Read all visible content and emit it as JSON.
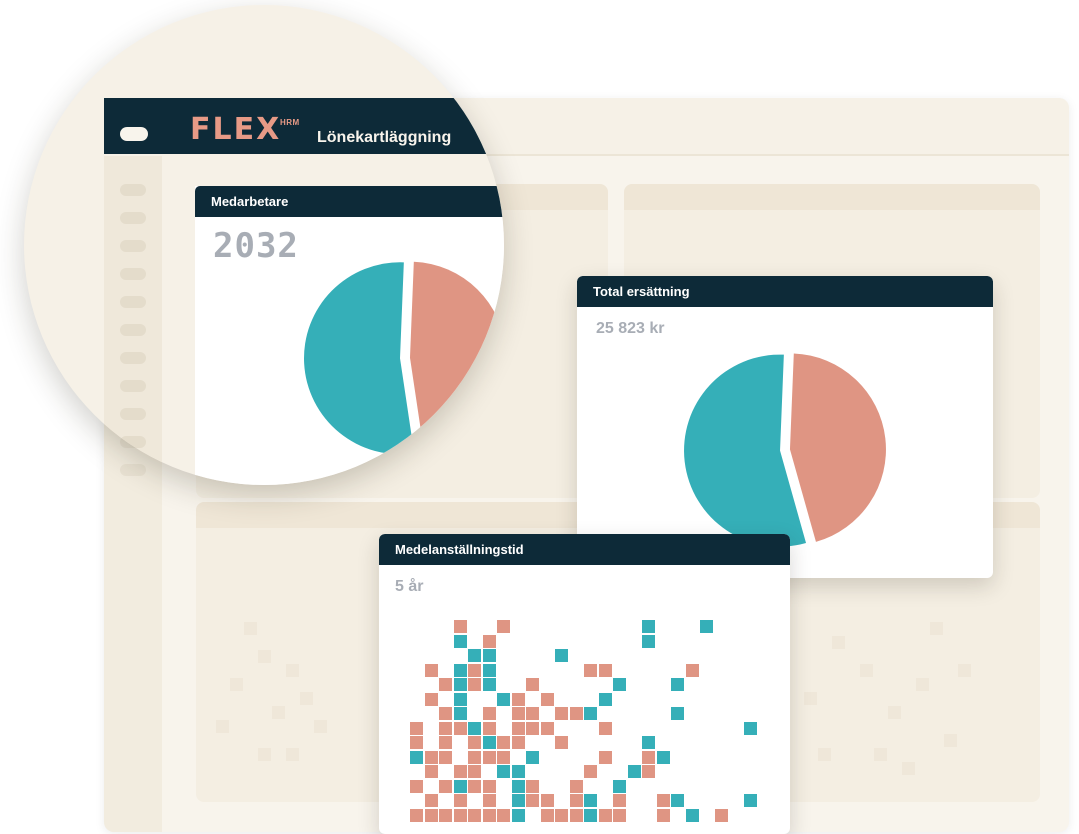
{
  "app": {
    "logo": "FLEX",
    "logo_sup": "HRM",
    "module_title": "Lönekartläggning"
  },
  "icons": {
    "menu": "menu-pill-icon"
  },
  "colors": {
    "navy": "#0d2a38",
    "teal": "#35afb8",
    "salmon": "#df9583",
    "cream": "#f8f4ec"
  },
  "cards": {
    "employees": {
      "title": "Medarbetare",
      "value": "2032"
    },
    "compensation": {
      "title": "Total ersättning",
      "value": "25 823 kr"
    },
    "tenure": {
      "title": "Medelanställningstid",
      "value": "5 år"
    }
  },
  "chart_data": [
    {
      "type": "pie",
      "title": "Medarbetare",
      "slices": [
        {
          "color": "#df9583",
          "value": 47
        },
        {
          "color": "#35afb8",
          "value": 53
        }
      ]
    },
    {
      "type": "pie",
      "title": "Total ersättning",
      "slices": [
        {
          "color": "#df9583",
          "value": 45
        },
        {
          "color": "#35afb8",
          "value": 55
        }
      ]
    },
    {
      "type": "heatmap",
      "title": "Medelanställningstid",
      "series": [
        {
          "color": "#df9583",
          "cells": [
            [
              3,
              0
            ],
            [
              6,
              0
            ],
            [
              5,
              1
            ],
            [
              1,
              3
            ],
            [
              4,
              3
            ],
            [
              12,
              3
            ],
            [
              13,
              3
            ],
            [
              19,
              3
            ],
            [
              2,
              4
            ],
            [
              4,
              4
            ],
            [
              8,
              4
            ],
            [
              1,
              5
            ],
            [
              3,
              5
            ],
            [
              7,
              5
            ],
            [
              9,
              5
            ],
            [
              2,
              6
            ],
            [
              3,
              6
            ],
            [
              5,
              6
            ],
            [
              7,
              6
            ],
            [
              8,
              6
            ],
            [
              10,
              6
            ],
            [
              11,
              6
            ],
            [
              0,
              7
            ],
            [
              2,
              7
            ],
            [
              3,
              7
            ],
            [
              5,
              7
            ],
            [
              7,
              7
            ],
            [
              8,
              7
            ],
            [
              9,
              7
            ],
            [
              13,
              7
            ],
            [
              0,
              8
            ],
            [
              2,
              8
            ],
            [
              4,
              8
            ],
            [
              6,
              8
            ],
            [
              7,
              8
            ],
            [
              10,
              8
            ],
            [
              1,
              9
            ],
            [
              2,
              9
            ],
            [
              4,
              9
            ],
            [
              5,
              9
            ],
            [
              6,
              9
            ],
            [
              13,
              9
            ],
            [
              16,
              9
            ],
            [
              1,
              10
            ],
            [
              3,
              10
            ],
            [
              4,
              10
            ],
            [
              6,
              10
            ],
            [
              7,
              10
            ],
            [
              12,
              10
            ],
            [
              16,
              10
            ],
            [
              0,
              11
            ],
            [
              2,
              11
            ],
            [
              3,
              11
            ],
            [
              4,
              11
            ],
            [
              5,
              11
            ],
            [
              8,
              11
            ],
            [
              11,
              11
            ],
            [
              1,
              12
            ],
            [
              3,
              12
            ],
            [
              5,
              12
            ],
            [
              8,
              12
            ],
            [
              9,
              12
            ],
            [
              11,
              12
            ],
            [
              14,
              12
            ],
            [
              17,
              12
            ],
            [
              0,
              13
            ],
            [
              1,
              13
            ],
            [
              2,
              13
            ],
            [
              3,
              13
            ],
            [
              4,
              13
            ],
            [
              5,
              13
            ],
            [
              6,
              13
            ],
            [
              9,
              13
            ],
            [
              10,
              13
            ],
            [
              11,
              13
            ],
            [
              13,
              13
            ],
            [
              14,
              13
            ],
            [
              17,
              13
            ],
            [
              21,
              13
            ]
          ]
        },
        {
          "color": "#35afb8",
          "cells": [
            [
              16,
              0
            ],
            [
              20,
              0
            ],
            [
              3,
              1
            ],
            [
              16,
              1
            ],
            [
              4,
              2
            ],
            [
              5,
              2
            ],
            [
              10,
              2
            ],
            [
              3,
              3
            ],
            [
              5,
              3
            ],
            [
              3,
              4
            ],
            [
              5,
              4
            ],
            [
              14,
              4
            ],
            [
              18,
              4
            ],
            [
              3,
              5
            ],
            [
              6,
              5
            ],
            [
              13,
              5
            ],
            [
              3,
              6
            ],
            [
              12,
              6
            ],
            [
              18,
              6
            ],
            [
              4,
              7
            ],
            [
              23,
              7
            ],
            [
              5,
              8
            ],
            [
              16,
              8
            ],
            [
              0,
              9
            ],
            [
              8,
              9
            ],
            [
              17,
              9
            ],
            [
              6,
              10
            ],
            [
              7,
              10
            ],
            [
              15,
              10
            ],
            [
              3,
              11
            ],
            [
              7,
              11
            ],
            [
              14,
              11
            ],
            [
              7,
              12
            ],
            [
              12,
              12
            ],
            [
              18,
              12
            ],
            [
              23,
              12
            ],
            [
              7,
              13
            ],
            [
              12,
              13
            ],
            [
              19,
              13
            ]
          ]
        }
      ]
    }
  ]
}
